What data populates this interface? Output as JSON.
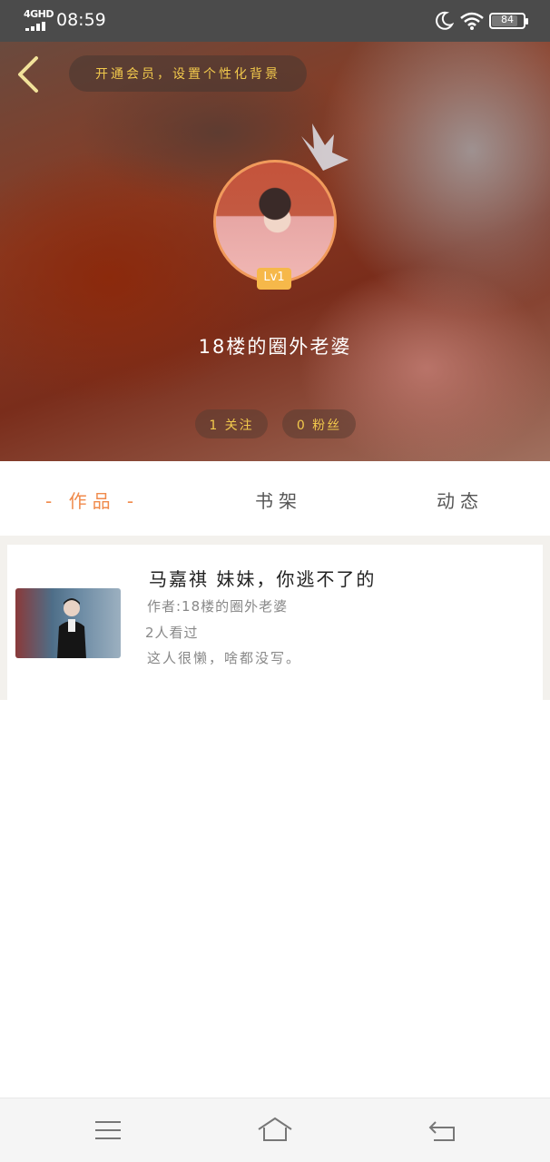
{
  "status_bar": {
    "network": "4GHD",
    "time": "08:59",
    "battery": "84",
    "battery_level": 84,
    "icons": [
      "signal-icon",
      "moon-icon",
      "wifi-icon",
      "battery-icon"
    ]
  },
  "header": {
    "back_icon": "chevron-left-icon",
    "vip_banner": "开通会员，设置个性化背景",
    "level": "Lv1",
    "username": "18楼的圈外老婆",
    "follow": "1 关注",
    "fans": "0 粉丝",
    "accent": "#f2c94c"
  },
  "tabs": [
    {
      "label": "- 作品 -",
      "active": true
    },
    {
      "label": "书架",
      "active": false
    },
    {
      "label": "动态",
      "active": false
    }
  ],
  "works": [
    {
      "title": "马嘉祺  妹妹，你逃不了的",
      "author": "作者:18楼的圈外老婆",
      "views": "2人看过",
      "description": "这人很懒，啥都没写。"
    }
  ],
  "nav_bar": {
    "icons": [
      "menu-icon",
      "home-icon",
      "back-icon"
    ]
  },
  "colors": {
    "tab_active": "#f08a4b",
    "avatar_ring": "#f19a5b",
    "level_badge": "#f6b84a"
  }
}
